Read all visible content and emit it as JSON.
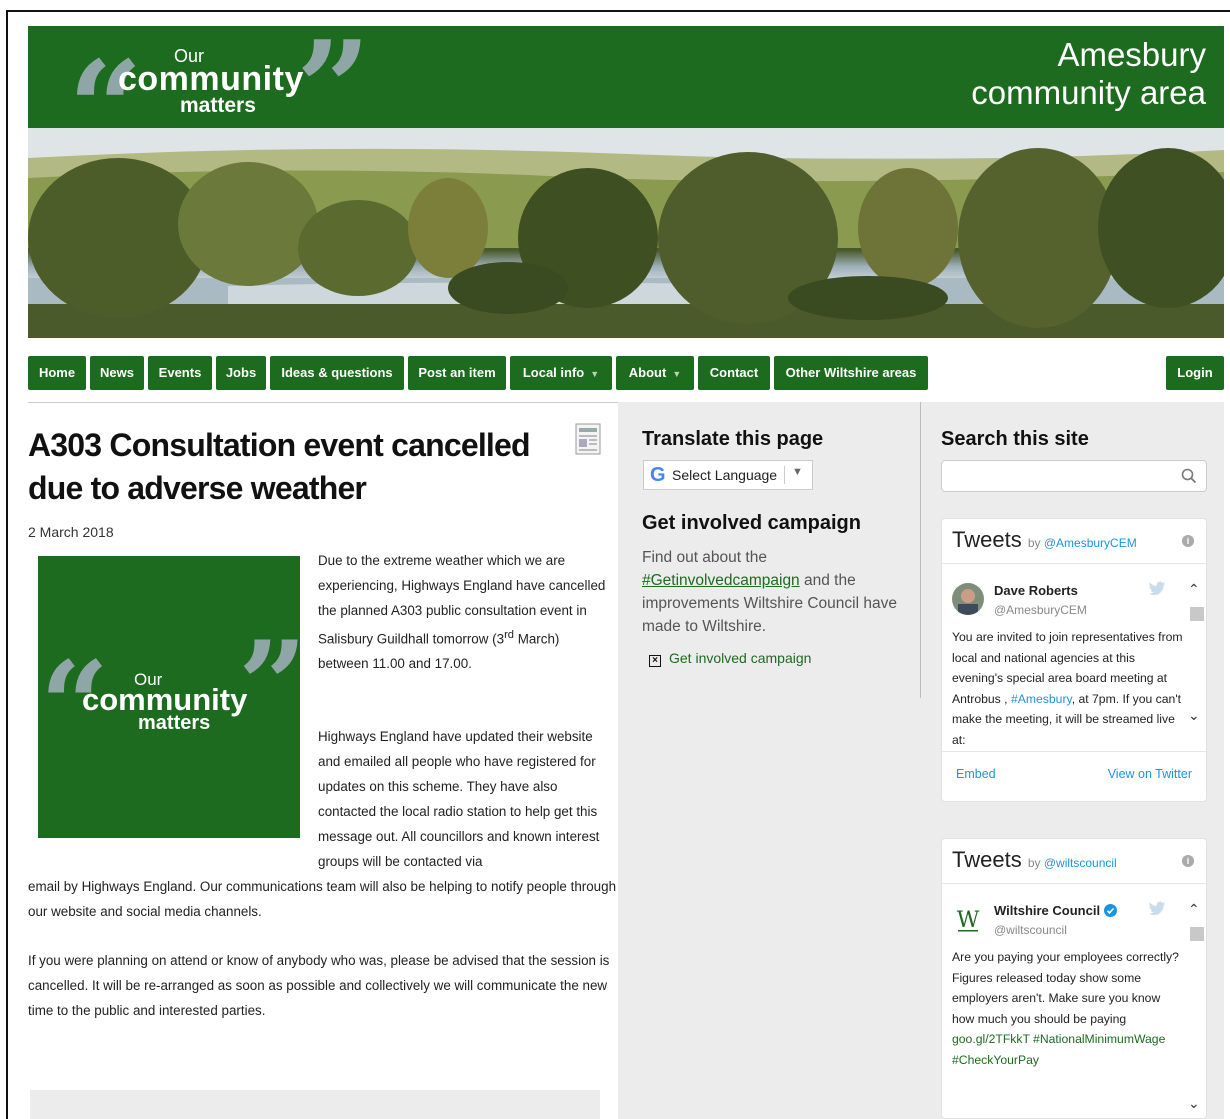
{
  "header": {
    "logo": {
      "our": "Our",
      "community": "community",
      "matters": "matters"
    },
    "area_title_line1": "Amesbury",
    "area_title_line2": "community area"
  },
  "nav": {
    "items": [
      {
        "label": "Home"
      },
      {
        "label": "News"
      },
      {
        "label": "Events"
      },
      {
        "label": "Jobs"
      },
      {
        "label": "Ideas & questions"
      },
      {
        "label": "Post an item"
      },
      {
        "label": "Local info",
        "dropdown": true
      },
      {
        "label": "About",
        "dropdown": true
      },
      {
        "label": "Contact"
      },
      {
        "label": "Other Wiltshire areas"
      }
    ],
    "login": "Login"
  },
  "article": {
    "title": "A303 Consultation event cancelled due to adverse weather",
    "date": "2 March 2018",
    "image_logo": {
      "our": "Our",
      "community": "community",
      "matters": "matters"
    },
    "p1_before": "Due to the extreme weather which we are experiencing, Highways England have cancelled the planned A303 public consultation event in Salisbury Guildhall tomorrow (3",
    "p1_sup": "rd",
    "p1_after": " March) between 11.00 and 17.00.",
    "p2_a": " Highways England have updated their website and emailed all people who have registered for updates on this scheme.  They have also contacted the local radio station to help get this message out.  All councillors and known interest groups will be contacted via",
    "p2_b": "email by Highways England.  Our communications team will also be helping to notify people through our website and social media channels.",
    "p3": " If you were planning on attend or know of anybody who was, please be advised that the session is cancelled.  It will be re-arranged as soon as possible and collectively we will communicate the new time to the public and interested parties."
  },
  "translate": {
    "heading": "Translate this page",
    "select_label": "Select Language"
  },
  "involved": {
    "heading": "Get involved campaign",
    "text_before": "Find out about the ",
    "link": "#Getinvolvedcampaign",
    "text_after": " and the improvements Wiltshire Council have made to Wiltshire.",
    "image_alt": "Get involved campaign"
  },
  "search": {
    "heading": "Search this site",
    "placeholder": ""
  },
  "tweets": [
    {
      "head": "Tweets",
      "by": "by ",
      "account": "@AmesburyCEM",
      "name": "Dave Roberts",
      "handle": "@AmesburyCEM",
      "body_a": "You are invited to join representatives from local and national agencies at this evening's special area board meeting at Antrobus , ",
      "body_tag": "#Amesbury",
      "body_b": ", at 7pm. If you can't make the meeting, it will be streamed live at:",
      "embed": "Embed",
      "view": "View on Twitter"
    },
    {
      "head": "Tweets",
      "by": "by ",
      "account": "@wiltscouncil",
      "name": "Wiltshire Council",
      "handle": "@wiltscouncil",
      "body_a": "Are you paying your employees correctly? Figures released today show some employers aren't. Make sure you know how much you should be paying ",
      "body_tag": "goo.gl/2TFkkT #NationalMinimumWage #CheckYourPay",
      "body_b": ""
    }
  ],
  "colors": {
    "brand_green": "#1d6b1f",
    "quote_grey": "#8fa6a6",
    "twitter_blue": "#1b95e0"
  }
}
